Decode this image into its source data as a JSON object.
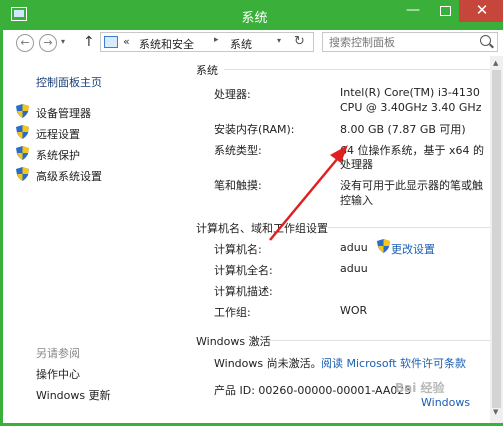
{
  "window": {
    "title": "系统"
  },
  "titlebar": {
    "minimize": "—",
    "close": "✕"
  },
  "address": {
    "back": "←",
    "forward": "→",
    "up": "↑",
    "crumbs": [
      "系统和安全",
      "系统"
    ],
    "search_placeholder": "搜索控制面板"
  },
  "sidebar": {
    "home": "控制面板主页",
    "items": [
      {
        "label": "设备管理器",
        "icon": "shield-icon"
      },
      {
        "label": "远程设置",
        "icon": "shield-icon"
      },
      {
        "label": "系统保护",
        "icon": "shield-icon"
      },
      {
        "label": "高级系统设置",
        "icon": "shield-icon"
      }
    ],
    "see_also": "另请参阅",
    "links": [
      "操作中心",
      "Windows 更新"
    ]
  },
  "system": {
    "heading": "系统",
    "processor_label": "处理器:",
    "processor_line1": "Intel(R) Core(TM) i3-4130",
    "processor_line2": "CPU @ 3.40GHz   3.40 GHz",
    "ram_label": "安装内存(RAM):",
    "ram_value": "8.00 GB (7.87 GB 可用)",
    "type_label": "系统类型:",
    "type_line1": "64 位操作系统，基于 x64 的",
    "type_line2": "处理器",
    "pen_label": "笔和触摸:",
    "pen_line1": "没有可用于此显示器的笔或触",
    "pen_line2": "控输入"
  },
  "computer": {
    "heading": "计算机名、域和工作组设置",
    "name_label": "计算机名:",
    "name_value": "aduu",
    "change_settings": "更改设置",
    "fullname_label": "计算机全名:",
    "fullname_value": "aduu",
    "desc_label": "计算机描述:",
    "workgroup_label": "工作组:",
    "workgroup_value": "WOR"
  },
  "activation": {
    "heading": "Windows 激活",
    "status": "Windows 尚未激活。",
    "license_link": "阅读 Microsoft 软件许可条款",
    "product_id": "产品 ID: 00260-00000-00001-AA025"
  },
  "watermark": {
    "text": "Bai 经验",
    "windows": "Windows"
  },
  "colors": {
    "titlebar": "#3ab03a",
    "close": "#c7463b",
    "link": "#1a5fb4",
    "arrow": "#e02020"
  }
}
